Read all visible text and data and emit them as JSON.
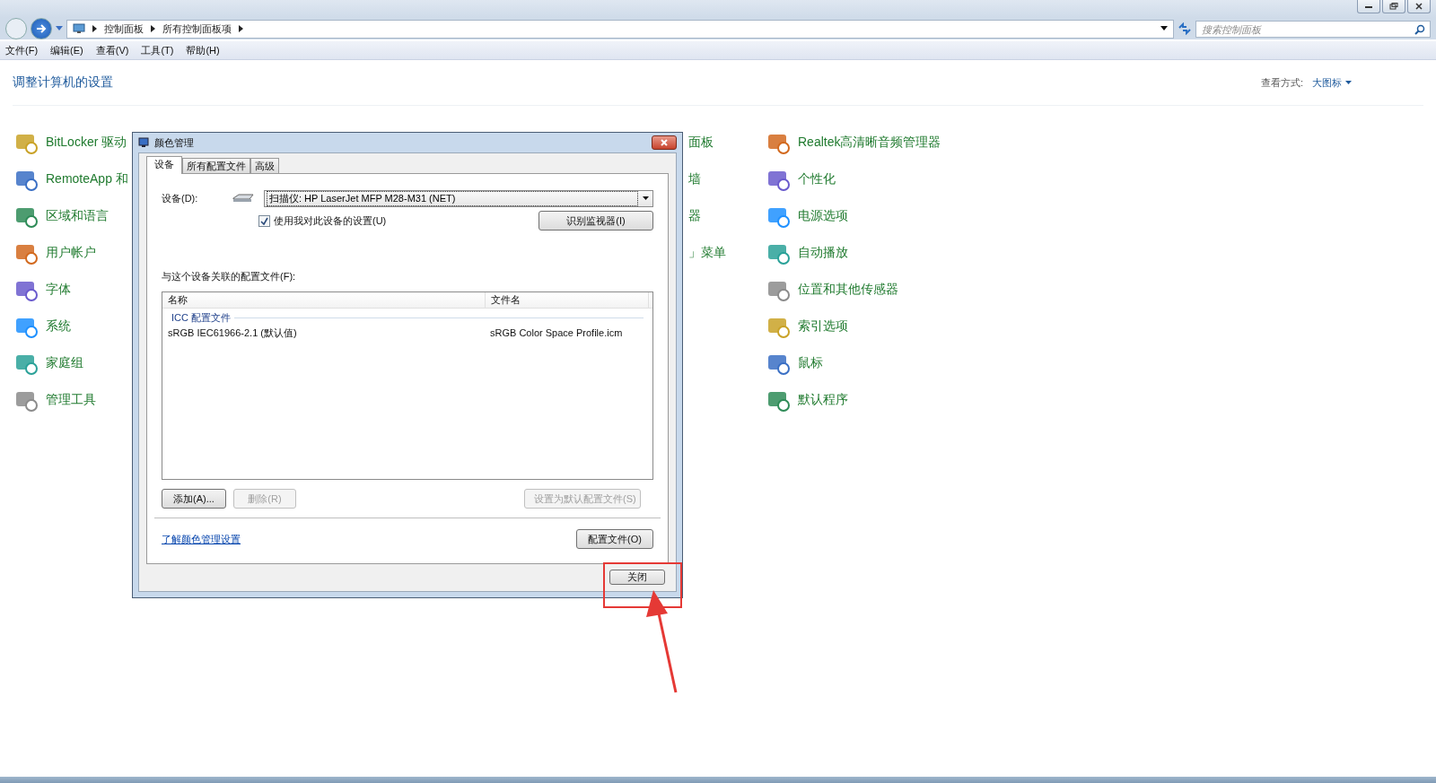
{
  "address_bar": {
    "breadcrumbs": [
      "控制面板",
      "所有控制面板项"
    ]
  },
  "search": {
    "placeholder": "搜索控制面板"
  },
  "menu": [
    "文件(F)",
    "编辑(E)",
    "查看(V)",
    "工具(T)",
    "帮助(H)"
  ],
  "heading": "调整计算机的设置",
  "view_by": {
    "label": "查看方式:",
    "value": "大图标"
  },
  "items_left": [
    "BitLocker 驱动",
    "RemoteApp 和",
    "区域和语言",
    "用户帐户",
    "字体",
    "系统",
    "家庭组",
    "管理工具"
  ],
  "items_middle": [
    "面板",
    "墙",
    "器",
    "」菜单"
  ],
  "items_right": [
    "Realtek高清晰音频管理器",
    "个性化",
    "电源选项",
    "自动播放",
    "位置和其他传感器",
    "索引选项",
    "鼠标",
    "默认程序"
  ],
  "dialog": {
    "title": "颜色管理",
    "tabs": [
      {
        "label": "设备",
        "selected": true
      },
      {
        "label": "所有配置文件",
        "selected": false
      },
      {
        "label": "高级",
        "selected": false
      }
    ],
    "device_label": "设备(D):",
    "device_value": "扫描仪: HP LaserJet MFP M28-M31 (NET)",
    "use_settings": {
      "label": "使用我对此设备的设置(U)",
      "checked": true
    },
    "identify_button": "识别监视器(I)",
    "profiles_label": "与这个设备关联的配置文件(F):",
    "table": {
      "columns": [
        "名称",
        "文件名"
      ],
      "group": "ICC 配置文件",
      "rows": [
        [
          "sRGB IEC61966-2.1 (默认值)",
          "sRGB Color Space Profile.icm"
        ]
      ]
    },
    "buttons": [
      {
        "label": "添加(A)...",
        "disabled": false
      },
      {
        "label": "删除(R)",
        "disabled": true
      },
      {
        "label": "设置为默认配置文件(S)",
        "disabled": true
      }
    ],
    "link": "了解颜色管理设置",
    "profiles_button": "配置文件(O)",
    "close_button": "关闭"
  }
}
